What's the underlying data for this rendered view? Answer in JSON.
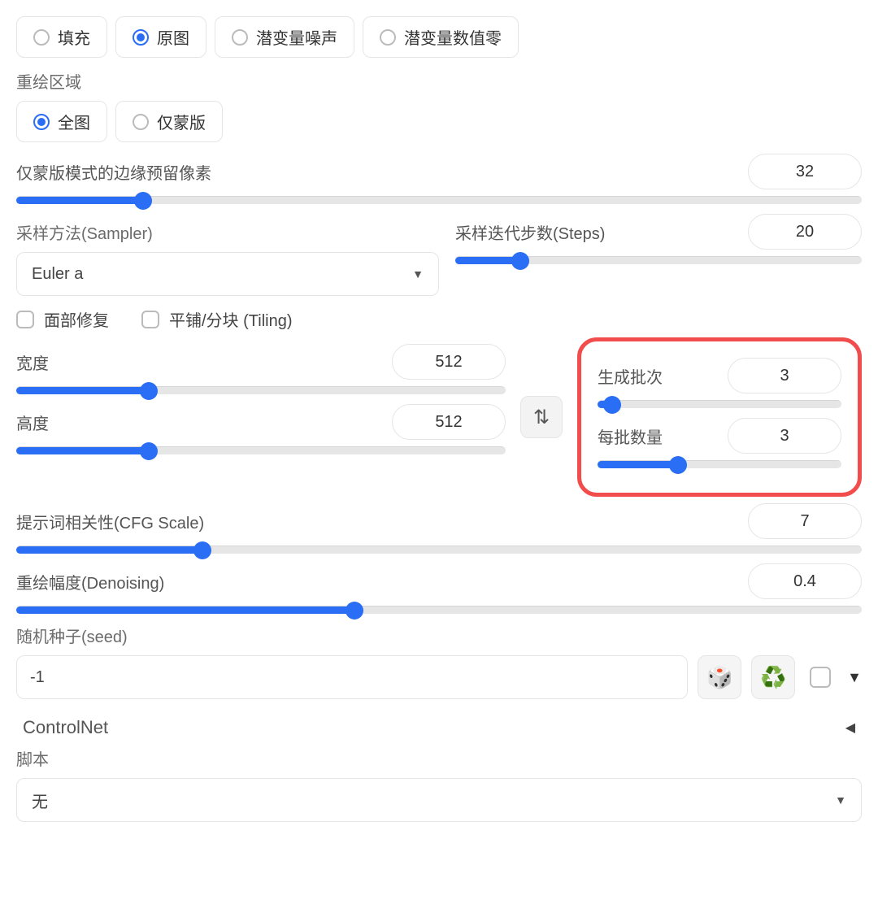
{
  "mask_content": {
    "options": [
      "填充",
      "原图",
      "潜变量噪声",
      "潜变量数值零"
    ],
    "selected_index": 1
  },
  "redraw_area": {
    "label": "重绘区域",
    "options": [
      "全图",
      "仅蒙版"
    ],
    "selected_index": 0
  },
  "mask_padding": {
    "label": "仅蒙版模式的边缘预留像素",
    "value": 32,
    "fill_pct": 15
  },
  "sampler": {
    "label": "采样方法(Sampler)",
    "value": "Euler a"
  },
  "steps": {
    "label": "采样迭代步数(Steps)",
    "value": 20,
    "fill_pct": 16
  },
  "face_restore": {
    "label": "面部修复",
    "checked": false
  },
  "tiling": {
    "label": "平铺/分块 (Tiling)",
    "checked": false
  },
  "width": {
    "label": "宽度",
    "value": 512,
    "fill_pct": 27
  },
  "height": {
    "label": "高度",
    "value": 512,
    "fill_pct": 27
  },
  "batch_count": {
    "label": "生成批次",
    "value": 3,
    "fill_pct": 6
  },
  "batch_size": {
    "label": "每批数量",
    "value": 3,
    "fill_pct": 33
  },
  "cfg": {
    "label": "提示词相关性(CFG Scale)",
    "value": 7,
    "fill_pct": 22
  },
  "denoise": {
    "label": "重绘幅度(Denoising)",
    "value": "0.4",
    "fill_pct": 40
  },
  "seed": {
    "label": "随机种子(seed)",
    "value": "-1"
  },
  "controlnet": {
    "label": "ControlNet"
  },
  "script": {
    "label": "脚本",
    "value": "无"
  },
  "icons": {
    "swap": "⇅",
    "dice": "🎲",
    "recycle": "♻️",
    "caret_down": "▼",
    "tri_left": "◀"
  }
}
